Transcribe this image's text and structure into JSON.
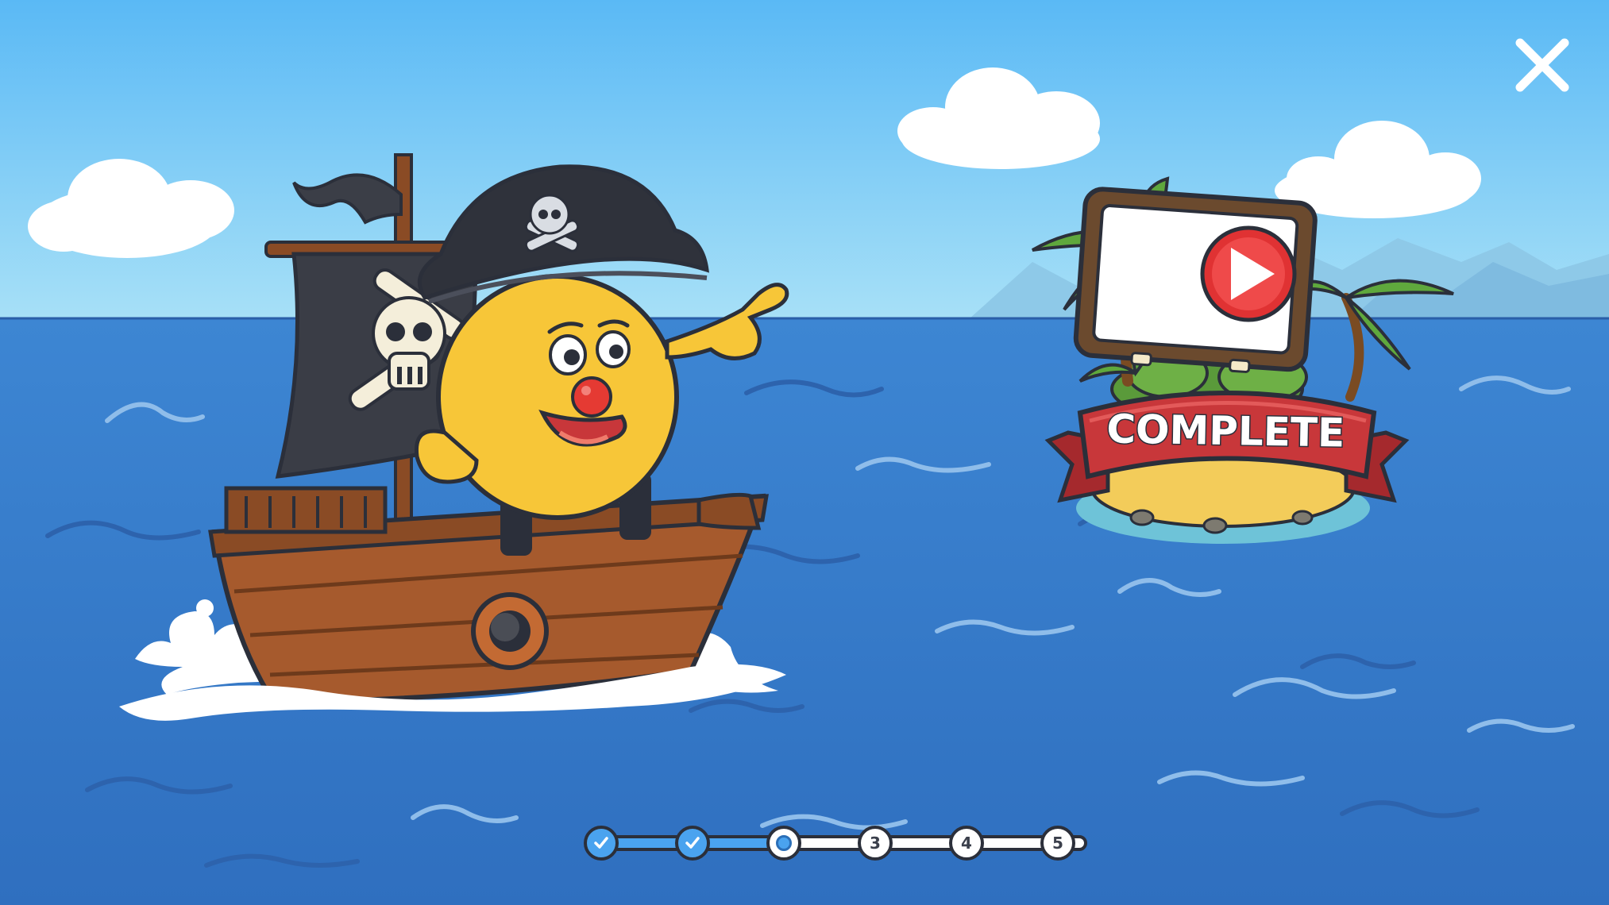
{
  "game": {
    "badge_label": "COMPLETE",
    "progress": {
      "steps": [
        {
          "label": "",
          "state": "done"
        },
        {
          "label": "",
          "state": "done"
        },
        {
          "label": "",
          "state": "current"
        },
        {
          "label": "3",
          "state": "upcoming"
        },
        {
          "label": "4",
          "state": "upcoming"
        },
        {
          "label": "5",
          "state": "upcoming"
        }
      ]
    }
  },
  "icons": {
    "close": "close-icon",
    "play": "play-icon",
    "check": "check-icon"
  },
  "colors": {
    "sky": "#6cc3f4",
    "sea": "#3a7cc9",
    "ribbon": "#c8373a",
    "play_button": "#e03233",
    "progress_done": "#4aa3ef",
    "character": "#f7c638"
  }
}
